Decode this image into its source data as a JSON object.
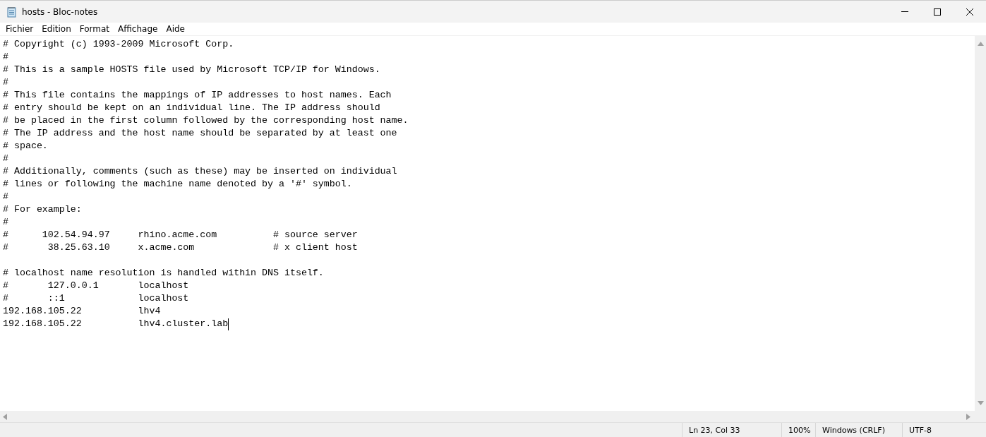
{
  "window": {
    "title": "hosts - Bloc-notes"
  },
  "menu": [
    {
      "label": "Fichier"
    },
    {
      "label": "Edition"
    },
    {
      "label": "Format"
    },
    {
      "label": "Affichage"
    },
    {
      "label": "Aide"
    }
  ],
  "editor": {
    "text": "# Copyright (c) 1993-2009 Microsoft Corp.\n#\n# This is a sample HOSTS file used by Microsoft TCP/IP for Windows.\n#\n# This file contains the mappings of IP addresses to host names. Each\n# entry should be kept on an individual line. The IP address should\n# be placed in the first column followed by the corresponding host name.\n# The IP address and the host name should be separated by at least one\n# space.\n#\n# Additionally, comments (such as these) may be inserted on individual\n# lines or following the machine name denoted by a '#' symbol.\n#\n# For example:\n#\n#      102.54.94.97     rhino.acme.com          # source server\n#       38.25.63.10     x.acme.com              # x client host\n\n# localhost name resolution is handled within DNS itself.\n#       127.0.0.1       localhost\n#       ::1             localhost\n192.168.105.22          lhv4\n192.168.105.22          lhv4.cluster.lab"
  },
  "status_bar": {
    "position": "Ln 23, Col 33",
    "zoom": "100%",
    "line_ending": "Windows (CRLF)",
    "encoding": "UTF-8"
  }
}
